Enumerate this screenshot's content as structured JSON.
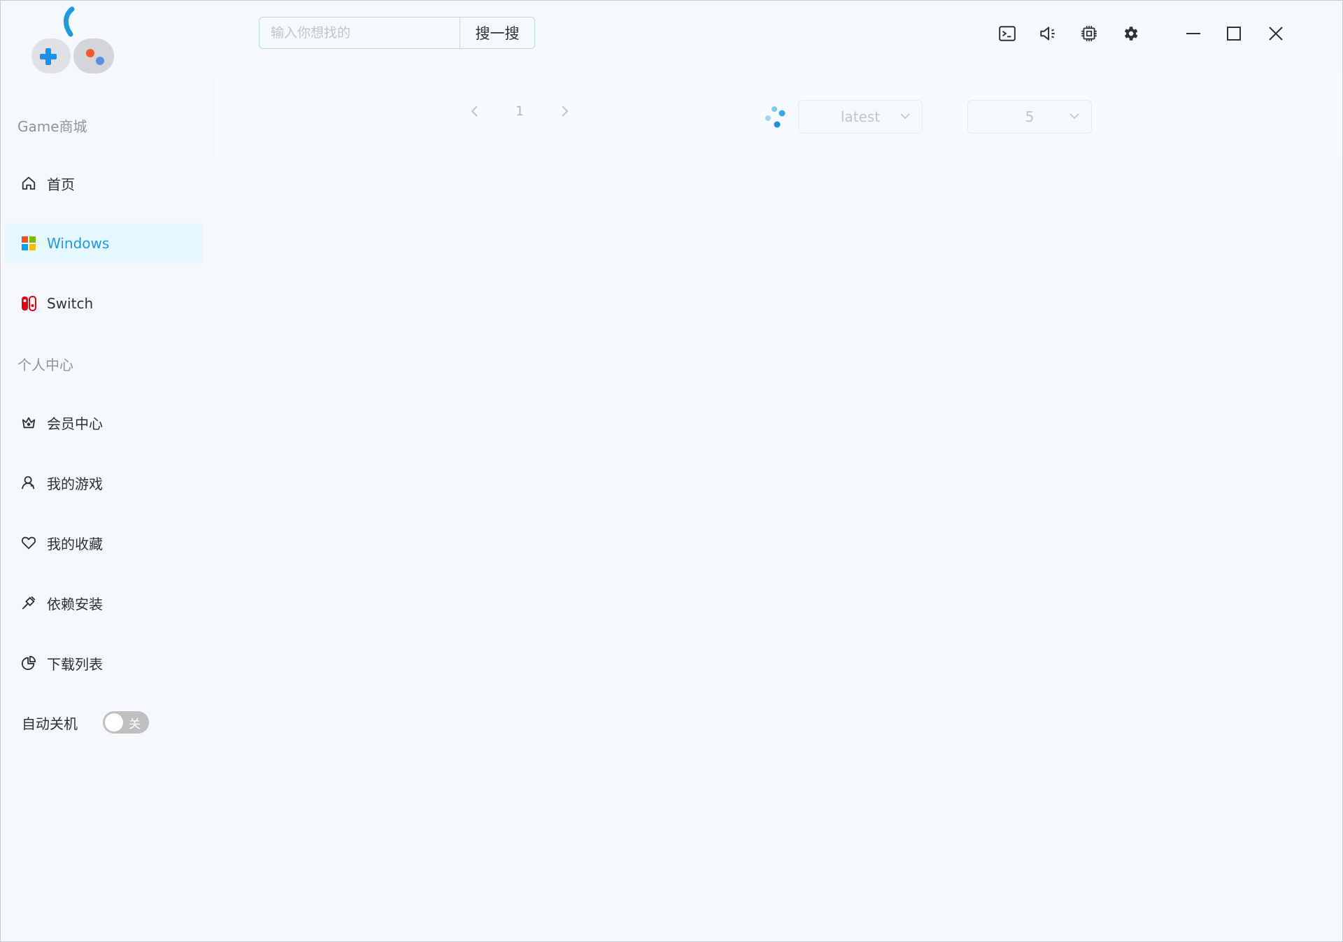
{
  "sidebar": {
    "group_store": "Game商城",
    "store_items": [
      {
        "label": "首页",
        "icon": "home-icon"
      },
      {
        "label": "Windows",
        "icon": "windows-logo-icon",
        "active": true
      },
      {
        "label": "Switch",
        "icon": "nintendo-switch-icon"
      }
    ],
    "group_personal": "个人中心",
    "personal_items": [
      {
        "label": "会员中心",
        "icon": "crown-icon"
      },
      {
        "label": "我的游戏",
        "icon": "user-icon"
      },
      {
        "label": "我的收藏",
        "icon": "heart-icon"
      },
      {
        "label": "依赖安装",
        "icon": "plug-icon"
      },
      {
        "label": "下载列表",
        "icon": "pie-chart-icon"
      }
    ],
    "auto_shutdown": {
      "label": "自动关机",
      "state_label": "关",
      "on": false
    }
  },
  "search": {
    "placeholder": "输入你想找的",
    "value": "",
    "button_label": "搜一搜"
  },
  "toolbar": {
    "icons": [
      "terminal-icon",
      "volume-icon",
      "cpu-icon",
      "gear-icon"
    ]
  },
  "window_controls": [
    "minimize-icon",
    "maximize-icon",
    "close-icon"
  ],
  "pagination": {
    "current_page": "1"
  },
  "sort_select": {
    "value": "latest"
  },
  "page_size_select": {
    "value": "5"
  },
  "colors": {
    "accent": "#1e9bdc",
    "active_bg": "#e6f7ff",
    "background": "#f5f9fe"
  }
}
